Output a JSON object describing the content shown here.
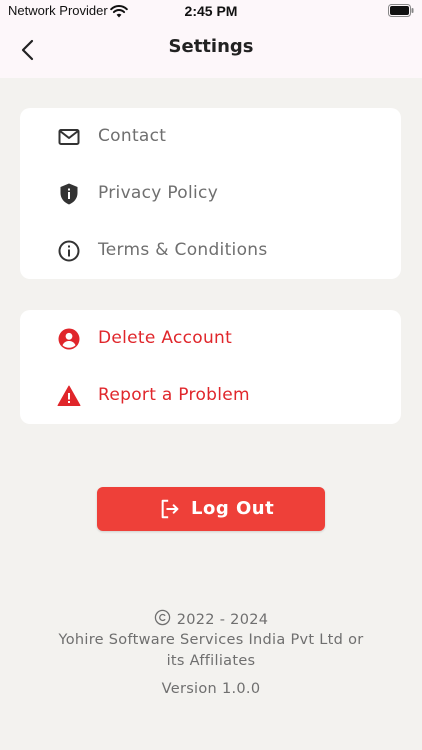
{
  "status_bar": {
    "carrier": "Network Provider",
    "time": "2:45 PM"
  },
  "header": {
    "title": "Settings",
    "back_icon": "chevron-left-icon"
  },
  "info_section": {
    "items": [
      {
        "label": "Contact",
        "icon": "mail-icon"
      },
      {
        "label": "Privacy Policy",
        "icon": "shield-icon"
      },
      {
        "label": "Terms & Conditions",
        "icon": "info-icon"
      }
    ]
  },
  "danger_section": {
    "items": [
      {
        "label": "Delete Account",
        "icon": "user-circle-icon"
      },
      {
        "label": "Report a Problem",
        "icon": "warning-icon"
      }
    ]
  },
  "logout": {
    "label": "Log Out",
    "icon": "logout-icon"
  },
  "footer": {
    "copyright": "2022 - 2024",
    "company_line1": "Yohire Software Services India Pvt Ltd or",
    "company_line2": "its Affiliates",
    "version": "Version 1.0.0"
  },
  "colors": {
    "accent": "#ee4039",
    "danger_text": "#e0262b",
    "background": "#f3f2ef",
    "header_background": "#fdf7fa"
  }
}
